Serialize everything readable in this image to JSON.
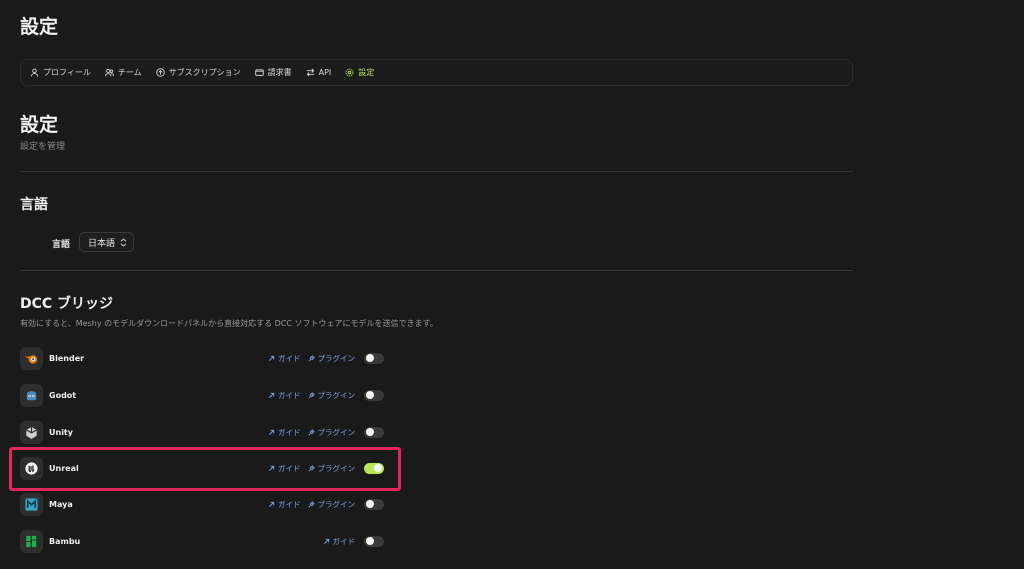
{
  "page": {
    "title": "設定"
  },
  "tabs": [
    {
      "label": "プロフィール",
      "icon": "user-icon",
      "active": false
    },
    {
      "label": "チーム",
      "icon": "users-icon",
      "active": false
    },
    {
      "label": "サブスクリプション",
      "icon": "arrow-up-circle-icon",
      "active": false
    },
    {
      "label": "請求書",
      "icon": "mail-icon",
      "active": false
    },
    {
      "label": "API",
      "icon": "swap-icon",
      "active": false
    },
    {
      "label": "設定",
      "icon": "gear-icon",
      "active": true
    }
  ],
  "settings": {
    "title": "設定",
    "subtitle": "設定を管理"
  },
  "language": {
    "heading": "言語",
    "label": "言語",
    "selected": "日本語"
  },
  "dcc": {
    "heading": "DCC ブリッジ",
    "description": "有効にすると、Meshy のモデルダウンロードパネルから直接対応する DCC ソフトウェアにモデルを送信できます。",
    "guide_label": "ガイド",
    "plugin_label": "プラグイン",
    "items": [
      {
        "name": "Blender",
        "icon": "blender-icon",
        "has_plugin": true,
        "enabled": false
      },
      {
        "name": "Godot",
        "icon": "godot-icon",
        "has_plugin": true,
        "enabled": false
      },
      {
        "name": "Unity",
        "icon": "unity-icon",
        "has_plugin": true,
        "enabled": false
      },
      {
        "name": "Unreal",
        "icon": "unreal-icon",
        "has_plugin": true,
        "enabled": true
      },
      {
        "name": "Maya",
        "icon": "maya-icon",
        "has_plugin": true,
        "enabled": false
      },
      {
        "name": "Bambu",
        "icon": "bambu-icon",
        "has_plugin": false,
        "enabled": false
      }
    ]
  },
  "colors": {
    "accent": "#b8e85a",
    "link": "#7aa8f0",
    "highlight": "#e8245c"
  }
}
